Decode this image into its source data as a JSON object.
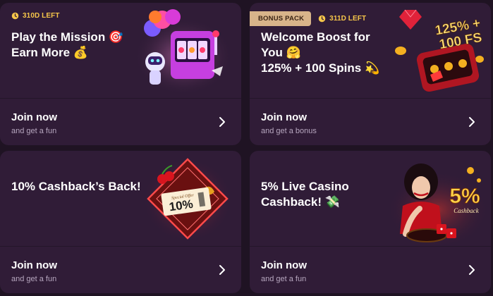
{
  "cards": [
    {
      "timer": "310D LEFT",
      "title_line1": "Play the Mission 🎯",
      "title_line2": "Earn More 💰",
      "join": "Join now",
      "sub": "and get a fun",
      "art": "slot-machine-robot-balloons"
    },
    {
      "badge": "BONUS PACK",
      "timer": "311D LEFT",
      "title_line1": "Welcome Boost for",
      "title_line2": "You 🤗",
      "title_line3": "125% + 100 Spins 💫",
      "art_text1": "125% +",
      "art_text2": "100 FS",
      "join": "Join now",
      "sub": "and get a bonus",
      "art": "slot-reels-gems"
    },
    {
      "title_line1": "10% Cashback’s Back!",
      "art_text": "10%",
      "art_subtext": "Special Offer",
      "join": "Join now",
      "sub": "and get a fun",
      "art": "neon-diamond-cherries-ticket"
    },
    {
      "title_line1": "5% Live Casino",
      "title_line2": "Cashback! 💸",
      "art_text": "5%",
      "art_subtext": "Cashback",
      "join": "Join now",
      "sub": "and get a fun",
      "art": "dealer-woman-roulette-dice"
    }
  ],
  "colors": {
    "page_bg": "#1f1323",
    "card_bg": "#301c37",
    "timer": "#f6c64a",
    "badge_bg": "#d8b48a",
    "sub_text": "#b7a7bf"
  }
}
